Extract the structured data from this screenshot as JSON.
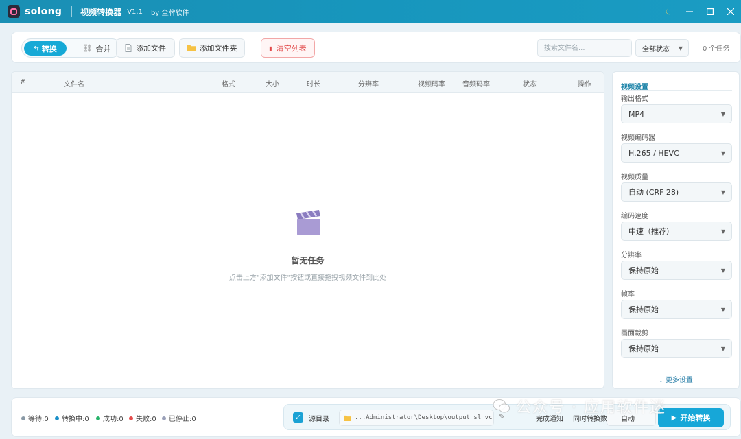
{
  "titlebar": {
    "brand": "solong",
    "app_title": "视频转换器",
    "version": "V1.1",
    "by": "by 全牌软件",
    "theme_icon": "moon-icon",
    "minimize_icon": "minimize-icon",
    "maximize_icon": "maximize-icon",
    "close_icon": "close-icon"
  },
  "toolbar": {
    "mode_convert": "转换",
    "mode_merge": "合并",
    "add_file": "添加文件",
    "add_folder": "添加文件夹",
    "clear_list": "清空列表",
    "search_placeholder": "搜索文件名...",
    "status_filter": "全部状态",
    "task_count": "0 个任务"
  },
  "table": {
    "columns": [
      "#",
      "文件名",
      "格式",
      "大小",
      "时长",
      "分辨率",
      "视频码率",
      "音频码率",
      "状态",
      "操作"
    ],
    "empty_title": "暂无任务",
    "empty_hint": "点击上方\"添加文件\"按钮或直接拖拽视频文件到此处"
  },
  "settings": {
    "title": "视频设置",
    "fields": [
      {
        "label": "输出格式",
        "value": "MP4"
      },
      {
        "label": "视频编码器",
        "value": "H.265 / HEVC"
      },
      {
        "label": "视频质量",
        "value": "自动 (CRF 28)"
      },
      {
        "label": "编码速度",
        "value": "中速（推荐）"
      },
      {
        "label": "分辨率",
        "value": "保持原始"
      },
      {
        "label": "帧率",
        "value": "保持原始"
      },
      {
        "label": "画面裁剪",
        "value": "保持原始"
      }
    ],
    "more": "更多设置"
  },
  "footer": {
    "stats": [
      {
        "label": "等待:0",
        "color": "#8a9aa6"
      },
      {
        "label": "转换中:0",
        "color": "#1a8fc8"
      },
      {
        "label": "成功:0",
        "color": "#27b36a"
      },
      {
        "label": "失败:0",
        "color": "#e44b4b"
      },
      {
        "label": "已停止:0",
        "color": "#9aa0b8"
      }
    ],
    "source_dir": "源目录",
    "output_path": "...Administrator\\Desktop\\output_sl_vc",
    "notify": "完成通知",
    "concurrent": "同时转换数",
    "auto": "自动",
    "start": "开始转换"
  },
  "watermark": "公众号 · 应用软件迷",
  "colors": {
    "accent": "#16a9d6",
    "titlebar": "#1796bd",
    "danger": "#e24848"
  }
}
